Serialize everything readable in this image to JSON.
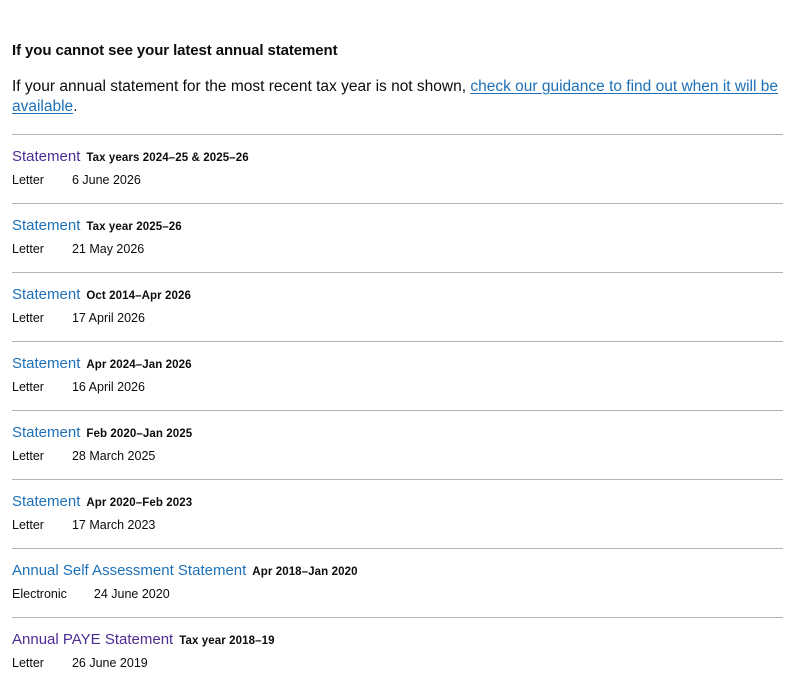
{
  "section": {
    "heading": "If you cannot see your latest annual statement",
    "intro_text": "If your annual statement for the most recent tax year is not shown, ",
    "intro_link": "check our guidance to find out when it will be available",
    "intro_end": "."
  },
  "statements": [
    {
      "title": "Statement",
      "period": "Tax years 2024–25 & 2025–26",
      "type": "Letter",
      "date": "6 June 2026",
      "visited": true
    },
    {
      "title": "Statement",
      "period": "Tax year 2025–26",
      "type": "Letter",
      "date": "21 May 2026",
      "visited": false
    },
    {
      "title": "Statement",
      "period": "Oct 2014–Apr 2026",
      "type": "Letter",
      "date": "17 April 2026",
      "visited": false
    },
    {
      "title": "Statement",
      "period": "Apr 2024–Jan 2026",
      "type": "Letter",
      "date": "16 April 2026",
      "visited": false
    },
    {
      "title": "Statement",
      "period": "Feb 2020–Jan 2025",
      "type": "Letter",
      "date": "28 March 2025",
      "visited": false
    },
    {
      "title": "Statement",
      "period": "Apr 2020–Feb 2023",
      "type": "Letter",
      "date": "17 March 2023",
      "visited": false
    },
    {
      "title": "Annual Self Assessment Statement",
      "period": "Apr 2018–Jan 2020",
      "type": "Electronic",
      "date": "24 June 2020",
      "visited": false
    },
    {
      "title": "Annual PAYE Statement",
      "period": "Tax year 2018–19",
      "type": "Letter",
      "date": "26 June 2019",
      "visited": true
    }
  ],
  "colors": {
    "link": "#1d70b8",
    "visited_link": "#4c2c92",
    "text": "#0b0c0c",
    "divider": "#b1b4b6"
  }
}
